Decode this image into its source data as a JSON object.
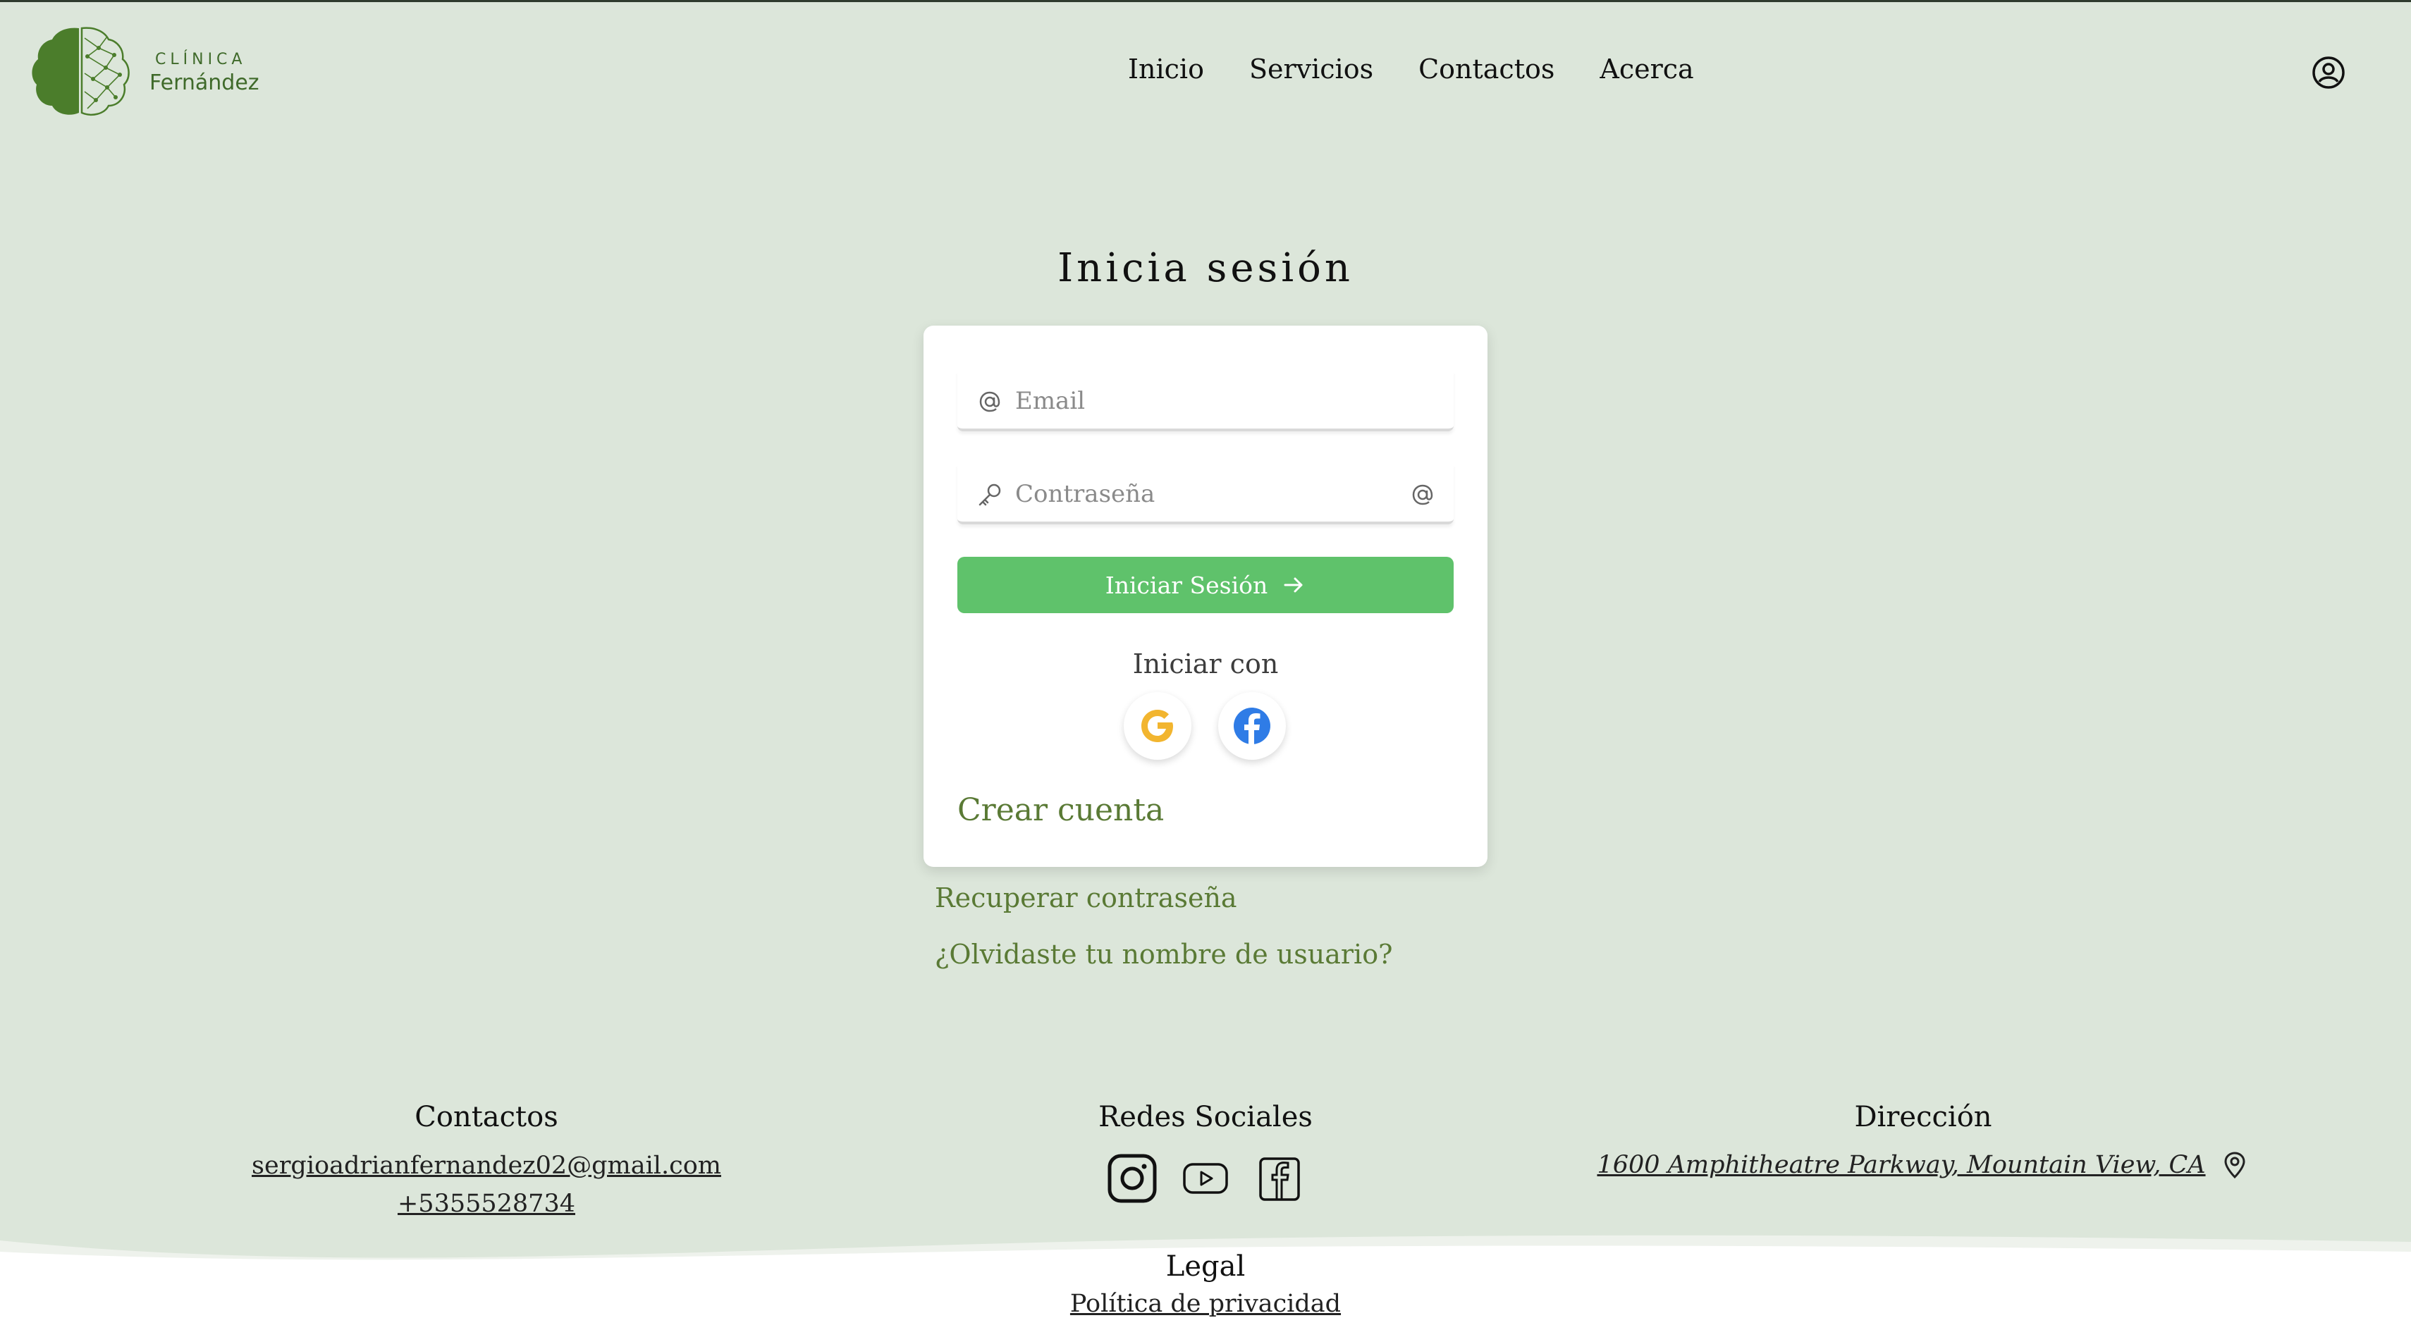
{
  "header": {
    "logo_top": "CLÍNICA",
    "logo_bottom": "Fernández",
    "nav": [
      "Inicio",
      "Servicios",
      "Contactos",
      "Acerca"
    ],
    "user_icon": "user-circle-icon"
  },
  "login": {
    "title": "Inicia sesión",
    "email_placeholder": "Email",
    "email_value": "",
    "password_placeholder": "Contraseña",
    "password_value": "",
    "submit_label": "Iniciar Sesión",
    "with_label": "Iniciar con",
    "providers": [
      "google-icon",
      "facebook-icon"
    ],
    "create_account": "Crear cuenta",
    "recover_password": "Recuperar contraseña",
    "forgot_username": "¿Olvidaste tu nombre de usuario?"
  },
  "footer": {
    "contacts_title": "Contactos",
    "email": "sergioadrianfernandez02@gmail.com",
    "phone": "+5355528734",
    "social_title": "Redes Sociales",
    "social_icons": [
      "instagram-icon",
      "youtube-icon",
      "facebook-icon"
    ],
    "address_title": "Dirección",
    "address": "1600 Amphitheatre Parkway, Mountain View, CA",
    "legal_title": "Legal",
    "privacy": "Política de privacidad"
  },
  "colors": {
    "background": "#dce6da",
    "accent_green": "#5fc26b",
    "link_green": "#5a7a35",
    "logo_green": "#3f6a2a"
  }
}
